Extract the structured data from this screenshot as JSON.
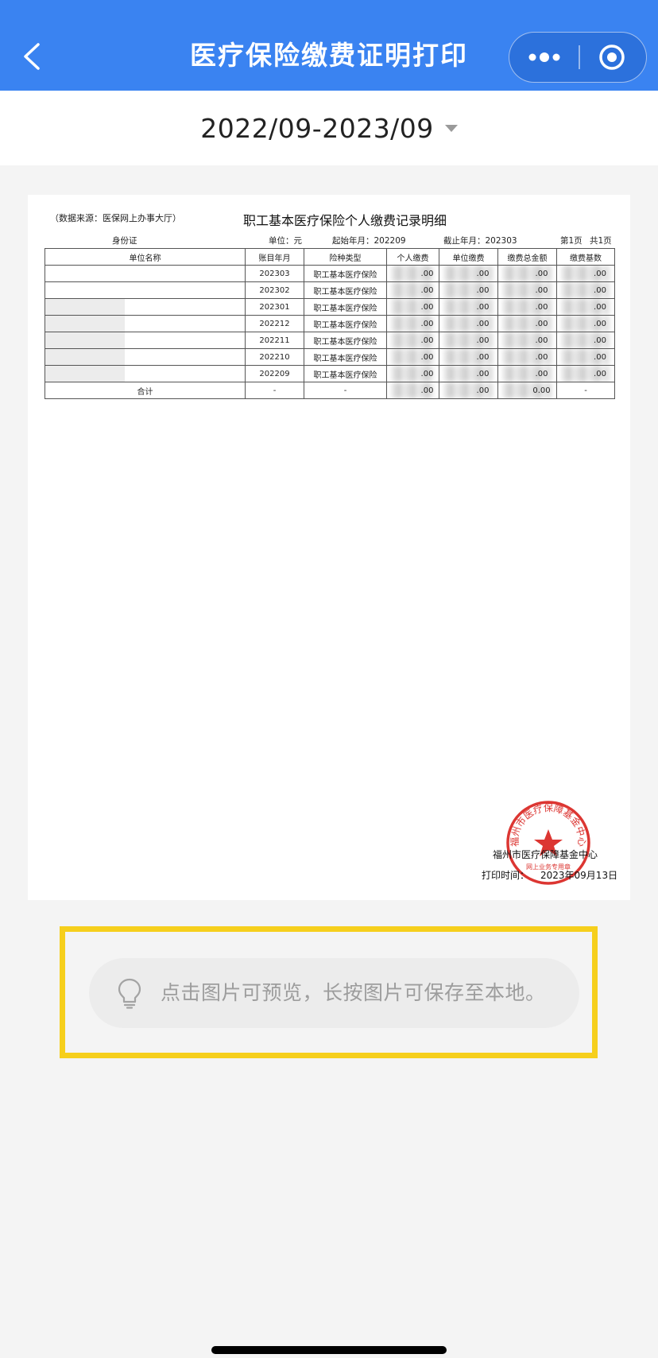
{
  "header": {
    "title": "医疗保险缴费证明打印"
  },
  "date_selector": {
    "value": "2022/09-2023/09"
  },
  "document": {
    "source": "（数据来源：医保网上办事大厅）",
    "title": "职工基本医疗保险个人缴费记录明细",
    "id_label": "身份证",
    "unit_label": "单位：元",
    "start_label": "起始年月：202209",
    "end_label": "截止年月：202303",
    "page_label": "第1页",
    "total_pages_label": "共1页",
    "columns": [
      "单位名称",
      "账目年月",
      "险种类型",
      "个人缴费",
      "单位缴费",
      "缴费总金额",
      "缴费基数"
    ],
    "rows": [
      {
        "month": "202303",
        "type": "职工基本医疗保险",
        "personal": ".00",
        "unit": ".00",
        "total": ".00",
        "base": ".00"
      },
      {
        "month": "202302",
        "type": "职工基本医疗保险",
        "personal": ".00",
        "unit": ".00",
        "total": ".00",
        "base": ".00"
      },
      {
        "month": "202301",
        "type": "职工基本医疗保险",
        "personal": ".00",
        "unit": ".00",
        "total": ".00",
        "base": ".00"
      },
      {
        "month": "202212",
        "type": "职工基本医疗保险",
        "personal": ".00",
        "unit": ".00",
        "total": ".00",
        "base": ".00"
      },
      {
        "month": "202211",
        "type": "职工基本医疗保险",
        "personal": ".00",
        "unit": ".00",
        "total": ".00",
        "base": ".00"
      },
      {
        "month": "202210",
        "type": "职工基本医疗保险",
        "personal": ".00",
        "unit": ".00",
        "total": ".00",
        "base": ".00"
      },
      {
        "month": "202209",
        "type": "职工基本医疗保险",
        "personal": ".00",
        "unit": ".00",
        "total": ".00",
        "base": ".00"
      }
    ],
    "total_row": {
      "label": "合计",
      "month": "-",
      "type": "-",
      "personal": ".00",
      "unit": ".00",
      "total": "0.00",
      "base": "-"
    },
    "stamp_org": "福州市医疗保障基金中心",
    "stamp_ring_text": "福州市医疗保障基金中心",
    "stamp_sub_text": "网上业务专用章",
    "print_time_label": "打印时间：",
    "print_time": "2023年09月13日"
  },
  "tip": {
    "text": "点击图片可预览，长按图片可保存至本地。"
  },
  "icons": {
    "back": "chevron-left-icon",
    "more": "more-dots-icon",
    "close": "target-close-icon",
    "caret": "caret-down-icon",
    "tip": "lightbulb-icon"
  },
  "colors": {
    "header_bg": "#3a83f1",
    "tip_frame": "#f6cf1c",
    "stamp_red": "#d8201c"
  }
}
